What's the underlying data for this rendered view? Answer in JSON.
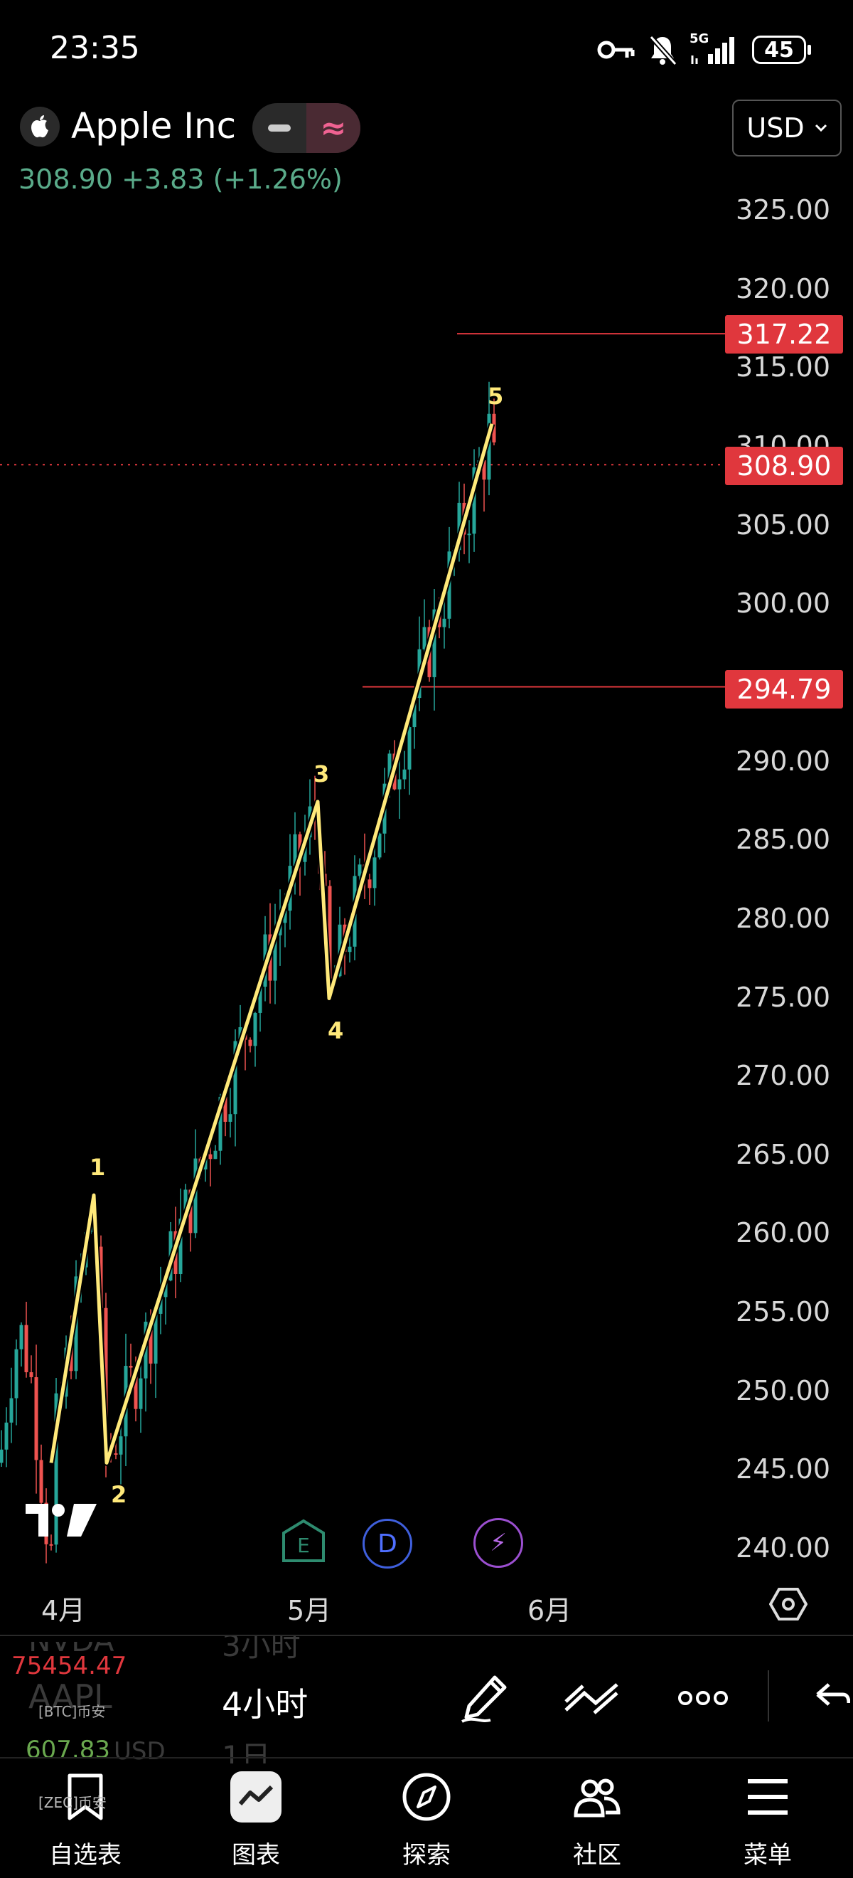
{
  "status_bar": {
    "time": "23:35",
    "network": "5G",
    "battery": "45",
    "icons": [
      "key-icon",
      "bell-off-icon",
      "signal-icon",
      "battery-icon"
    ]
  },
  "header": {
    "symbol_name": "Apple Inc",
    "price": "308.90",
    "change": "+3.83",
    "change_pct": "(+1.26%)",
    "currency": "USD",
    "colors": {
      "up": "#5aab8a",
      "accent_pink": "#f06292"
    }
  },
  "chart": {
    "y_labels": [
      "325.00",
      "320.00",
      "315.00",
      "310.00",
      "305.00",
      "300.00",
      "295.00",
      "290.00",
      "285.00",
      "280.00",
      "275.00",
      "270.00",
      "265.00",
      "260.00",
      "255.00",
      "250.00",
      "245.00",
      "240.00"
    ],
    "price_boxes": {
      "upper": "317.22",
      "current": "308.90",
      "lower": "294.79"
    },
    "months": [
      "4月",
      "5月",
      "6月"
    ],
    "wave_labels": [
      "1",
      "2",
      "3",
      "4",
      "5"
    ],
    "colors": {
      "up": "#26a69a",
      "down": "#ef5350",
      "wave": "#ffe97a",
      "price_line": "#e0373d"
    }
  },
  "chart_data": {
    "type": "candlestick",
    "symbol": "Apple Inc",
    "ylim": [
      240,
      325
    ],
    "x_ticks": [
      "4月",
      "5月",
      "6月"
    ],
    "horizontal_lines": [
      317.22,
      294.79
    ],
    "current_price": 308.9,
    "elliott_wave": [
      {
        "label": "",
        "price": 245.5
      },
      {
        "label": "1",
        "price": 262.5
      },
      {
        "label": "2",
        "price": 245.5
      },
      {
        "label": "3",
        "price": 287.5
      },
      {
        "label": "4",
        "price": 275
      },
      {
        "label": "5",
        "price": 311.5
      }
    ]
  },
  "toolbar": {
    "interval": "4小时",
    "interval_above": "3小时",
    "interval_below": "1日",
    "watchlist": [
      {
        "symbol": "NVDA",
        "price": "75454.47",
        "sub": "[BTC]币安",
        "color": "#e0373d"
      },
      {
        "symbol": "AAPL",
        "price": "607.83",
        "sub": "[ZEC]币安",
        "unit": "USD",
        "color": "#6aa84f"
      }
    ],
    "icons": [
      "pencil-icon",
      "trend-lines-icon",
      "more-icon",
      "undo-icon"
    ]
  },
  "nav": {
    "items": [
      {
        "label": "自选表",
        "icon": "bookmark-icon"
      },
      {
        "label": "图表",
        "icon": "chart-icon"
      },
      {
        "label": "探索",
        "icon": "compass-icon"
      },
      {
        "label": "社区",
        "icon": "community-icon"
      },
      {
        "label": "菜单",
        "icon": "menu-icon"
      }
    ]
  }
}
